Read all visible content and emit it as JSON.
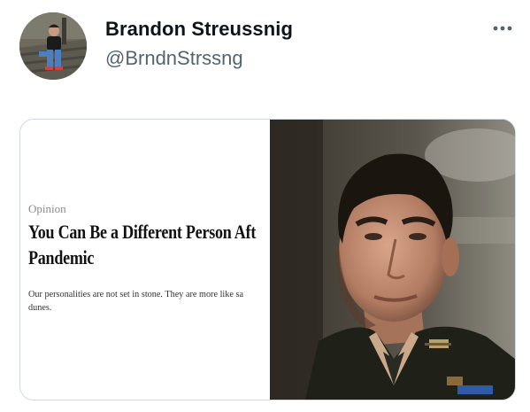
{
  "tweet": {
    "display_name": "Brandon Streussnig",
    "handle": "@BrndnStrssng",
    "more_icon": "more-horizontal-icon"
  },
  "media": {
    "article": {
      "section": "Opinion",
      "headline_line1": "You Can Be a Different Person Aft",
      "headline_line2": "Pandemic",
      "dek_line1": "Our personalities are not set in stone. They are more like sa",
      "dek_line2": "dunes."
    },
    "photo": "man-in-military-uniform-photo"
  },
  "colors": {
    "name": "#0f1419",
    "handle": "#536471",
    "border": "#cfd9de"
  }
}
